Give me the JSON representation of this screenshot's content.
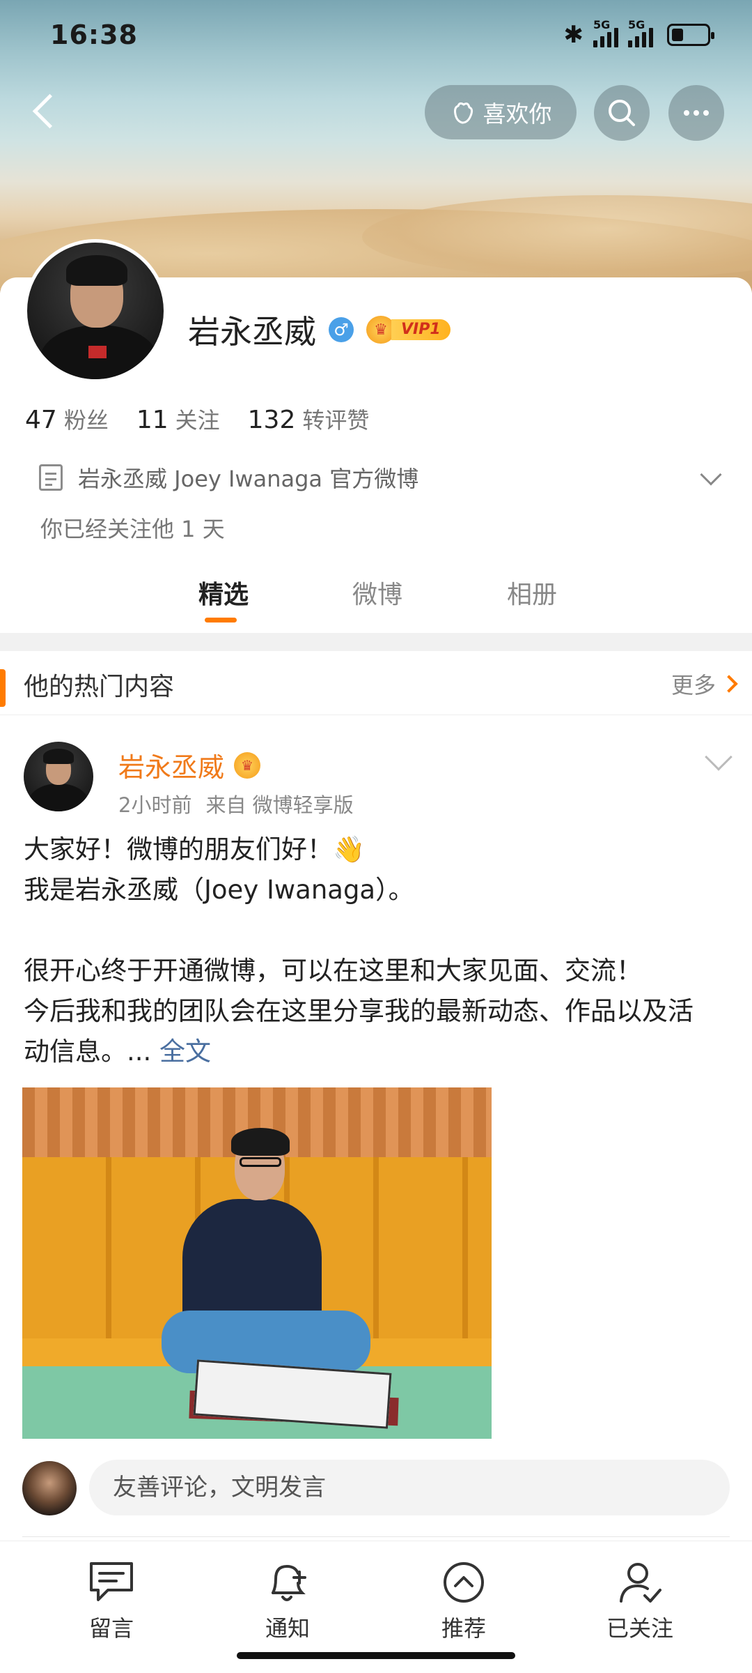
{
  "status_bar": {
    "time": "16:38",
    "signal1": "5G",
    "signal2": "5G"
  },
  "top_nav": {
    "like_label": "喜欢你"
  },
  "profile": {
    "name": "岩永丞威",
    "gender_symbol": "♂",
    "vip_label": "VIP1",
    "stats": [
      {
        "num": "47",
        "label": "粉丝"
      },
      {
        "num": "11",
        "label": "关注"
      },
      {
        "num": "132",
        "label": "转评赞"
      }
    ],
    "description": "岩永丞威 Joey Iwanaga 官方微博",
    "follow_since": "你已经关注他 1 天"
  },
  "tabs": [
    "精选",
    "微博",
    "相册"
  ],
  "hot_section": {
    "title": "他的热门内容",
    "more": "更多"
  },
  "post": {
    "author": "岩永丞威",
    "time": "2小时前",
    "source": "来自 微博轻享版",
    "lines": [
      "大家好！微博的朋友们好！👋",
      "我是岩永丞威（Joey Iwanaga）。",
      "",
      "很开心终于开通微博，可以在这里和大家见面、交流！",
      "今后我和我的团队会在这里分享我的最新动态、作品以及活",
      "动信息。... "
    ],
    "full_text_link": "全文"
  },
  "comment": {
    "placeholder": "友善评论，文明发言"
  },
  "bottom_nav": [
    {
      "label": "留言",
      "icon": "message-icon"
    },
    {
      "label": "通知",
      "icon": "bell-plus-icon"
    },
    {
      "label": "推荐",
      "icon": "arrow-up-circle-icon"
    },
    {
      "label": "已关注",
      "icon": "user-check-icon"
    }
  ],
  "colors": {
    "accent": "#ff7b00",
    "author": "#f07a1a",
    "link": "#4a6fa0"
  }
}
